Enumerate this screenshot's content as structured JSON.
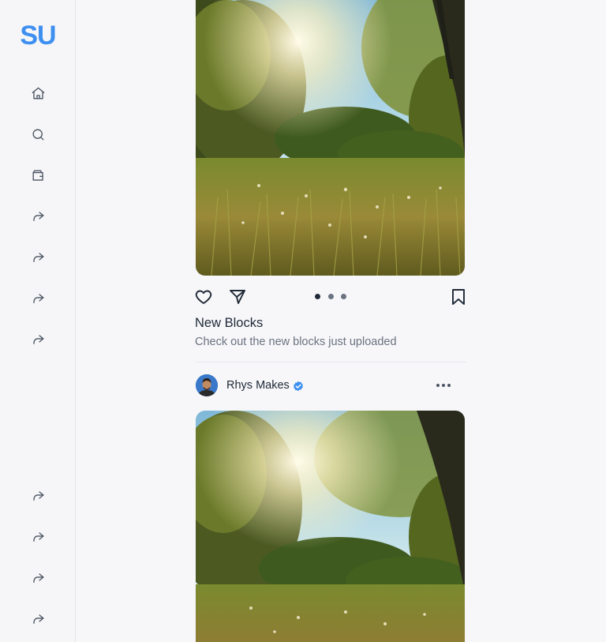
{
  "brand": {
    "logo_text": "SU",
    "accent": "#3d8ff0"
  },
  "sidebar": {
    "top_items": [
      {
        "icon": "home-icon"
      },
      {
        "icon": "search-icon"
      },
      {
        "icon": "wallet-icon"
      },
      {
        "icon": "share-arrow-icon"
      },
      {
        "icon": "share-arrow-icon"
      },
      {
        "icon": "share-arrow-icon"
      },
      {
        "icon": "share-arrow-icon"
      }
    ],
    "bottom_items": [
      {
        "icon": "share-arrow-icon"
      },
      {
        "icon": "share-arrow-icon"
      },
      {
        "icon": "share-arrow-icon"
      },
      {
        "icon": "share-arrow-icon"
      }
    ]
  },
  "feed": {
    "posts": [
      {
        "image": "sunlit meadow with trees",
        "actions": [
          "heart-icon",
          "send-icon",
          "bookmark-icon"
        ],
        "carousel": {
          "count": 3,
          "active": 1
        },
        "title": "New Blocks",
        "caption": "Check out the new blocks just uploaded"
      },
      {
        "author": {
          "name": "Rhys Makes",
          "verified": true,
          "verified_color": "#3d8ff0"
        },
        "more_icon": "more-horizontal-icon",
        "image": "sunlit meadow with trees"
      }
    ]
  }
}
